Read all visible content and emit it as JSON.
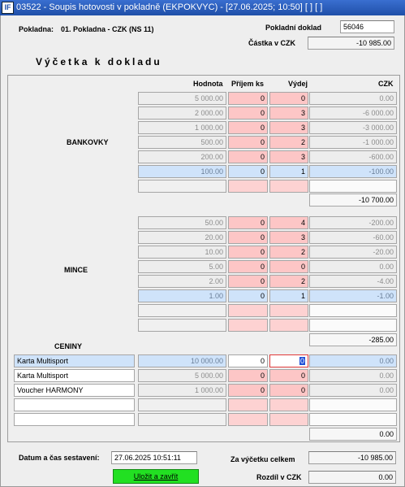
{
  "window": {
    "icon_label": "IF",
    "title": "03522 - Soupis hotovosti v pokladně (EKPOKVYC) - [27.06.2025; 10:50]  [ ]  [ ]"
  },
  "header": {
    "pokladna_label": "Pokladna:",
    "pokladna_value": "01. Pokladna - CZK (NS 11)",
    "doklad_label": "Pokladní doklad",
    "doklad_value": "56046",
    "castka_label": "Částka v CZK",
    "castka_value": "-10 985.00"
  },
  "section_title": "Výčetka k dokladu",
  "columns": {
    "hodnota": "Hodnota",
    "prijem": "Příjem ks",
    "vydej": "Výdej",
    "czk": "CZK"
  },
  "bankovky": {
    "label": "BANKOVKY",
    "rows": [
      {
        "hodnota": "5 000.00",
        "prijem": "0",
        "vydej": "0",
        "czk": "0.00"
      },
      {
        "hodnota": "2 000.00",
        "prijem": "0",
        "vydej": "3",
        "czk": "-6 000.00"
      },
      {
        "hodnota": "1 000.00",
        "prijem": "0",
        "vydej": "3",
        "czk": "-3 000.00"
      },
      {
        "hodnota": "500.00",
        "prijem": "0",
        "vydej": "2",
        "czk": "-1 000.00"
      },
      {
        "hodnota": "200.00",
        "prijem": "0",
        "vydej": "3",
        "czk": "-600.00"
      },
      {
        "hodnota": "100.00",
        "prijem": "0",
        "vydej": "1",
        "czk": "-100.00"
      }
    ],
    "total": "-10 700.00"
  },
  "mince": {
    "label": "MINCE",
    "rows": [
      {
        "hodnota": "50.00",
        "prijem": "0",
        "vydej": "4",
        "czk": "-200.00"
      },
      {
        "hodnota": "20.00",
        "prijem": "0",
        "vydej": "3",
        "czk": "-60.00"
      },
      {
        "hodnota": "10.00",
        "prijem": "0",
        "vydej": "2",
        "czk": "-20.00"
      },
      {
        "hodnota": "5.00",
        "prijem": "0",
        "vydej": "0",
        "czk": "0.00"
      },
      {
        "hodnota": "2.00",
        "prijem": "0",
        "vydej": "2",
        "czk": "-4.00"
      },
      {
        "hodnota": "1.00",
        "prijem": "0",
        "vydej": "1",
        "czk": "-1.00"
      }
    ],
    "total": "-285.00"
  },
  "ceniny": {
    "label": "CENINY",
    "rows": [
      {
        "nazev": "Karta Multisport",
        "hodnota": "10 000.00",
        "prijem": "0",
        "vydej": "0",
        "czk": "0.00"
      },
      {
        "nazev": "Karta Multisport",
        "hodnota": "5 000.00",
        "prijem": "0",
        "vydej": "0",
        "czk": "0.00"
      },
      {
        "nazev": "Voucher HARMONY",
        "hodnota": "1 000.00",
        "prijem": "0",
        "vydej": "0",
        "czk": "0.00"
      }
    ],
    "total": "0.00"
  },
  "footer": {
    "datum_label": "Datum a čas sestavení:",
    "datum_value": "27.06.2025 10:51:11",
    "celkem_label": "Za výčetku celkem",
    "celkem_value": "-10 985.00",
    "rozdil_label": "Rozdíl v CZK",
    "rozdil_value": "0.00",
    "save_button": "Uložit a zavřít"
  },
  "colors": {
    "titlebar": "#1f4fa8",
    "pink": "#fdc6c6",
    "blue": "#cfe3fa",
    "save": "#22e022"
  }
}
